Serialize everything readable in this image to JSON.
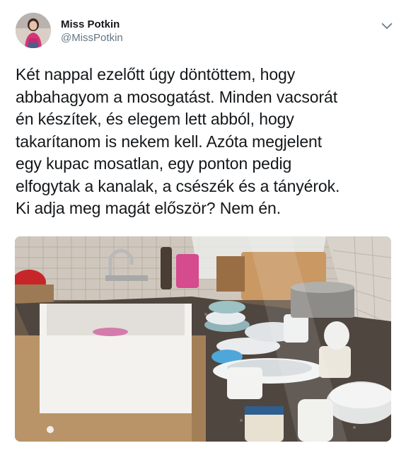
{
  "tweet": {
    "author": {
      "display_name": "Miss Potkin",
      "handle": "@MissPotkin"
    },
    "text": "Két nappal ezelőtt úgy döntöttem, hogy\nabbahagyom a mosogatást. Minden vacsorát\nén készítek, és elegem lett abból, hogy\ntakarítanom is nekem kell. Azóta megjelent\negy kupac mosatlan, egy ponton pedig\nelfogytak a kanalak, a csészék és a tányérok.\nKi adja meg magát először? Nem én.",
    "menu_icon": "chevron-down-icon",
    "photo_subject": "kitchen-sink-with-pile-of-dirty-dishes"
  },
  "colors": {
    "text_primary": "#14171a",
    "text_secondary": "#657786",
    "icon": "#657786"
  }
}
